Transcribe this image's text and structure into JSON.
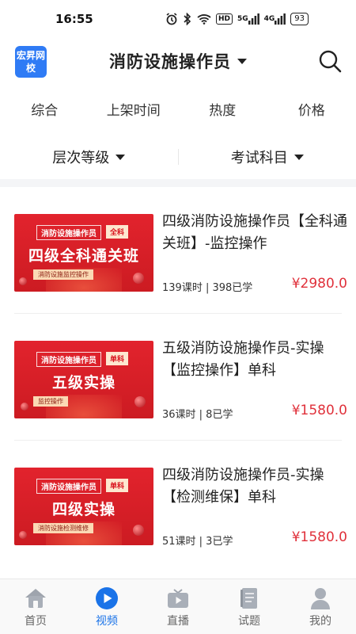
{
  "status_bar": {
    "time": "16:55",
    "battery": "93",
    "hd": "HD",
    "signal1": "5G",
    "signal2": "4G"
  },
  "header": {
    "logo_text": "宏昇网校",
    "title": "消防设施操作员",
    "search_icon": "search-icon"
  },
  "sort_tabs": [
    {
      "label": "综合"
    },
    {
      "label": "上架时间"
    },
    {
      "label": "热度"
    },
    {
      "label": "价格"
    }
  ],
  "filters": [
    {
      "label": "层次等级"
    },
    {
      "label": "考试科目"
    }
  ],
  "courses": [
    {
      "title": "四级消防设施操作员【全科通关班】-监控操作",
      "meta": "139课时 | 398已学",
      "price": "¥2980.0",
      "thumb": {
        "series": "消防设施操作员",
        "tag": "全科",
        "main": "四级全科通关班",
        "sub": "消防设施监控操作"
      }
    },
    {
      "title": "五级消防设施操作员-实操【监控操作】单科",
      "meta": "36课时 | 8已学",
      "price": "¥1580.0",
      "thumb": {
        "series": "消防设施操作员",
        "tag": "单科",
        "main": "五级实操",
        "sub": "监控操作"
      }
    },
    {
      "title": "四级消防设施操作员-实操【检测维保】单科",
      "meta": "51课时 | 3已学",
      "price": "¥1580.0",
      "thumb": {
        "series": "消防设施操作员",
        "tag": "单科",
        "main": "四级实操",
        "sub": "消防设施检测维修"
      }
    }
  ],
  "bottom_nav": [
    {
      "label": "首页",
      "icon": "home-icon",
      "active": false
    },
    {
      "label": "视频",
      "icon": "play-icon",
      "active": true
    },
    {
      "label": "直播",
      "icon": "tv-icon",
      "active": false
    },
    {
      "label": "试题",
      "icon": "book-icon",
      "active": false
    },
    {
      "label": "我的",
      "icon": "user-icon",
      "active": false
    }
  ],
  "colors": {
    "accent": "#1a73e8",
    "price": "#e0313b",
    "thumb_red": "#e2232d",
    "logo_blue": "#2f7bf5"
  }
}
